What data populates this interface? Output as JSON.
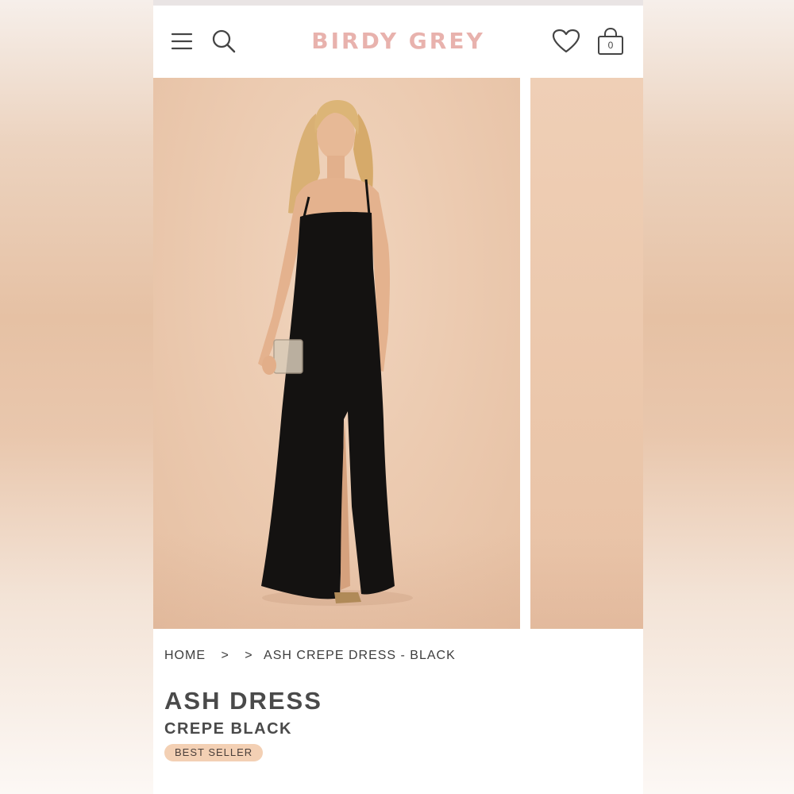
{
  "header": {
    "brand": "BIRDY GREY",
    "cart_count": "0",
    "icons": [
      "menu-icon",
      "search-icon",
      "heart-icon",
      "shopping-bag-icon"
    ],
    "brand_color": "#e8b2ad"
  },
  "gallery": {
    "slides": 2,
    "main_image": "model wearing black crepe slip dress with front slit, holding clear clutch, peach backdrop",
    "background_color": "#ecccb2"
  },
  "breadcrumb": {
    "home": "HOME",
    "sep1": ">",
    "sep2": ">",
    "current": "ASH CREPE DRESS - BLACK"
  },
  "product": {
    "title": "ASH DRESS",
    "subtitle": "CREPE BLACK",
    "badge": "BEST SELLER",
    "badge_color": "#f3d0b4"
  }
}
